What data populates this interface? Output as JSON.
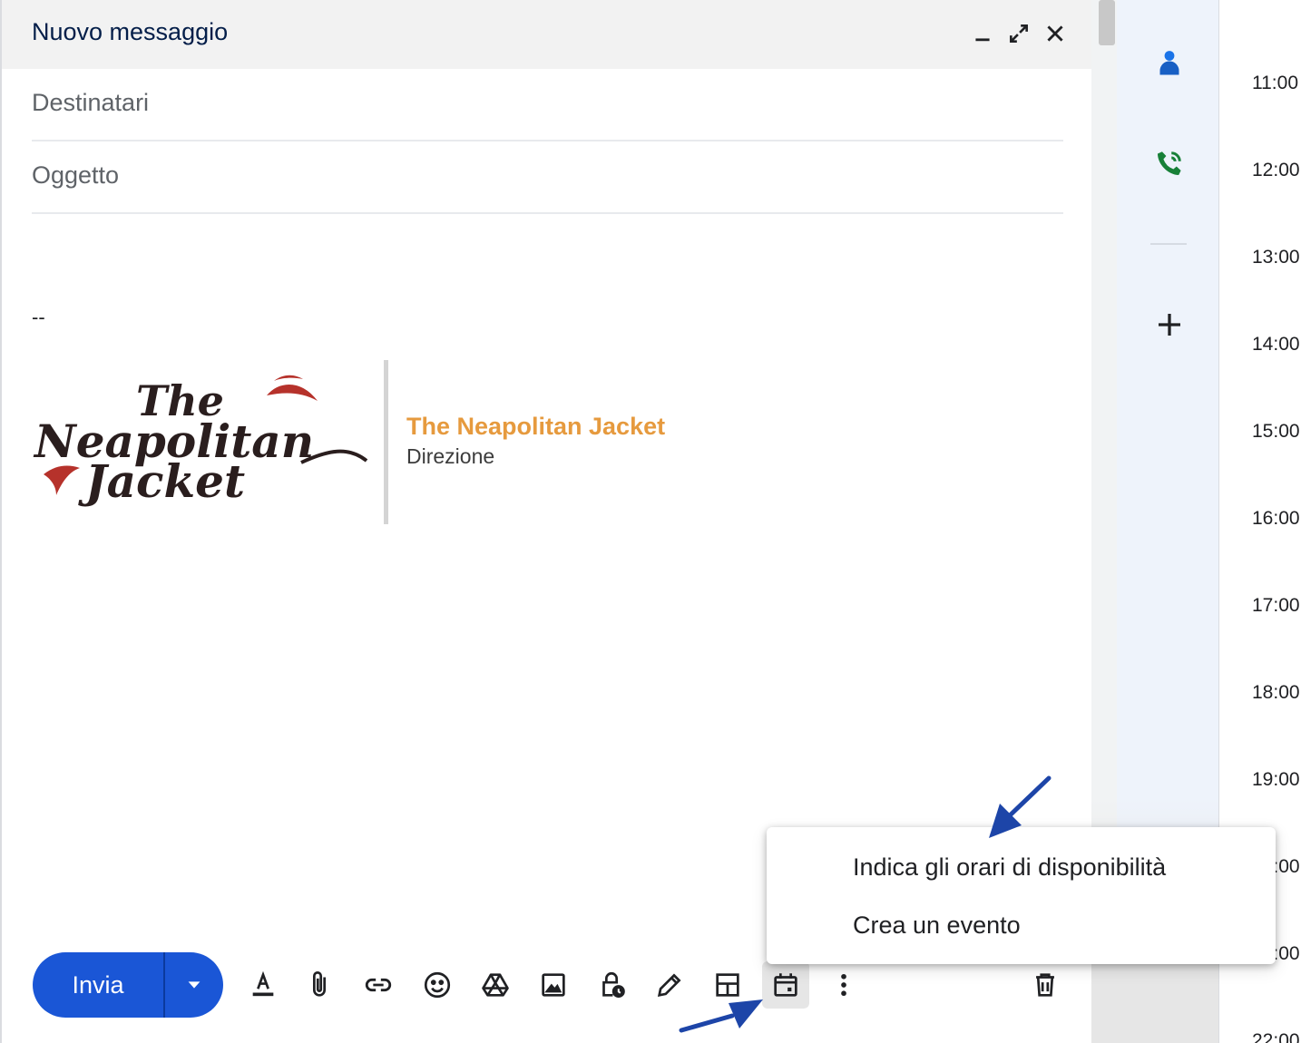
{
  "compose": {
    "title": "Nuovo messaggio",
    "recipients_placeholder": "Destinatari",
    "subject_placeholder": "Oggetto",
    "signature": {
      "separator": "--",
      "logo_text": [
        "The",
        "Neapolitan",
        "Jacket"
      ],
      "company": "The Neapolitan Jacket",
      "role": "Direzione"
    },
    "send_label": "Invia"
  },
  "calendar": {
    "hours": [
      "11:00",
      "12:00",
      "13:00",
      "14:00",
      "15:00",
      "16:00",
      "17:00",
      "18:00",
      "19:00",
      "20:00",
      "21:00",
      "22:00"
    ]
  },
  "menu": {
    "items": [
      "Indica gli orari di disponibilità",
      "Crea un evento"
    ]
  },
  "colors": {
    "accent": "#1a56d6",
    "signature_name": "#e69a3e",
    "annotation_arrow": "#1d45a8"
  },
  "icons": {
    "header": [
      "minimize-icon",
      "expand-icon",
      "close-icon"
    ],
    "toolbar": [
      "text-format-icon",
      "attach-icon",
      "link-icon",
      "emoji-icon",
      "drive-icon",
      "photo-icon",
      "confidential-icon",
      "signature-icon",
      "layout-icon",
      "calendar-event-icon",
      "more-options-icon",
      "trash-icon"
    ],
    "side": [
      "contacts-icon",
      "call-icon",
      "add-icon"
    ]
  }
}
